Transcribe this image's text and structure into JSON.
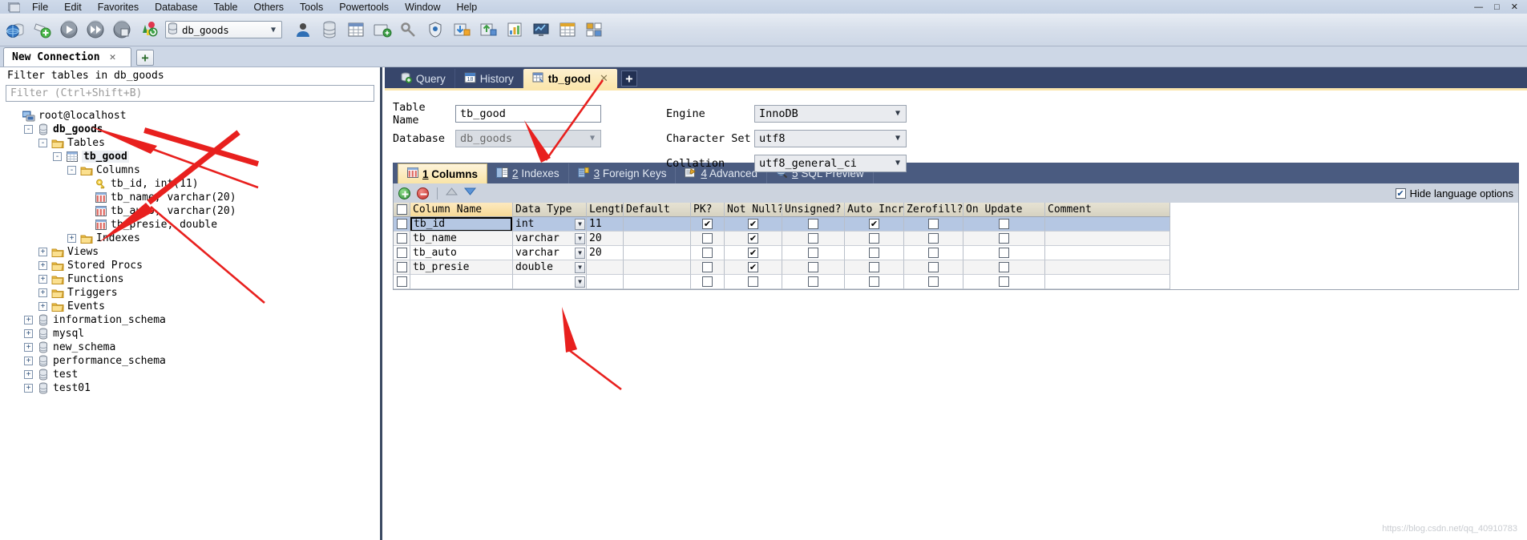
{
  "window": {
    "menu_items": [
      "File",
      "Edit",
      "Favorites",
      "Database",
      "Table",
      "Others",
      "Tools",
      "Powertools",
      "Window",
      "Help"
    ],
    "minimize_label": "—",
    "maximize_label": "□",
    "close_label": "✕",
    "app_icon": "app-window-icon"
  },
  "toolbar": {
    "buttons": [
      {
        "name": "new-connection-icon",
        "glyph": "connection"
      },
      {
        "name": "new-database-icon",
        "glyph": "newdb"
      },
      {
        "name": "execute-icon",
        "glyph": "play"
      },
      {
        "name": "execute-all-icon",
        "glyph": "forward"
      },
      {
        "name": "stop-icon",
        "glyph": "stop"
      },
      {
        "name": "refresh-objects-icon",
        "glyph": "refresh"
      }
    ],
    "db_selector": {
      "value": "db_goods",
      "icon": "database-icon",
      "chevron": "chevron-down-icon"
    },
    "right_buttons": [
      {
        "name": "user-manager-icon",
        "glyph": "user"
      },
      {
        "name": "database-icon",
        "glyph": "db"
      },
      {
        "name": "table-data-icon",
        "glyph": "table"
      },
      {
        "name": "backup-icon",
        "glyph": "backup"
      },
      {
        "name": "key-icon",
        "glyph": "key"
      },
      {
        "name": "security-icon",
        "glyph": "shield"
      },
      {
        "name": "import-icon",
        "glyph": "import"
      },
      {
        "name": "export-icon",
        "glyph": "export"
      },
      {
        "name": "report-icon",
        "glyph": "report"
      },
      {
        "name": "monitor-icon",
        "glyph": "monitor"
      },
      {
        "name": "grid-view-icon",
        "glyph": "grid"
      },
      {
        "name": "tile-view-icon",
        "glyph": "tile"
      }
    ]
  },
  "connection_tabs": {
    "tabs": [
      {
        "label": "New Connection",
        "close": "✕"
      }
    ],
    "add_label": "+"
  },
  "sidebar": {
    "filter_title": "Filter tables in db_goods",
    "filter_placeholder": "Filter (Ctrl+Shift+B)",
    "tree": [
      {
        "label": "root@localhost",
        "indent": 0,
        "expander": "",
        "icon": "server-icon",
        "bold": false,
        "selected": false
      },
      {
        "label": "db_goods",
        "indent": 1,
        "expander": "-",
        "icon": "database-icon",
        "bold": true,
        "selected": false
      },
      {
        "label": "Tables",
        "indent": 2,
        "expander": "-",
        "icon": "folder-icon",
        "bold": false,
        "selected": false
      },
      {
        "label": "tb_good",
        "indent": 3,
        "expander": "-",
        "icon": "table-icon",
        "bold": true,
        "selected": true
      },
      {
        "label": "Columns",
        "indent": 4,
        "expander": "-",
        "icon": "folder-icon",
        "bold": false,
        "selected": false
      },
      {
        "label": "tb_id, int(11)",
        "indent": 5,
        "expander": "",
        "icon": "key-icon",
        "bold": false,
        "selected": false
      },
      {
        "label": "tb_name, varchar(20)",
        "indent": 5,
        "expander": "",
        "icon": "column-icon",
        "bold": false,
        "selected": false
      },
      {
        "label": "tb_auto, varchar(20)",
        "indent": 5,
        "expander": "",
        "icon": "column-icon",
        "bold": false,
        "selected": false
      },
      {
        "label": "tb_presie, double",
        "indent": 5,
        "expander": "",
        "icon": "column-icon",
        "bold": false,
        "selected": false
      },
      {
        "label": "Indexes",
        "indent": 4,
        "expander": "+",
        "icon": "folder-icon",
        "bold": false,
        "selected": false
      },
      {
        "label": "Views",
        "indent": 2,
        "expander": "+",
        "icon": "folder-icon",
        "bold": false,
        "selected": false
      },
      {
        "label": "Stored Procs",
        "indent": 2,
        "expander": "+",
        "icon": "folder-icon",
        "bold": false,
        "selected": false
      },
      {
        "label": "Functions",
        "indent": 2,
        "expander": "+",
        "icon": "folder-icon",
        "bold": false,
        "selected": false
      },
      {
        "label": "Triggers",
        "indent": 2,
        "expander": "+",
        "icon": "folder-icon",
        "bold": false,
        "selected": false
      },
      {
        "label": "Events",
        "indent": 2,
        "expander": "+",
        "icon": "folder-icon",
        "bold": false,
        "selected": false
      },
      {
        "label": "information_schema",
        "indent": 1,
        "expander": "+",
        "icon": "database-icon",
        "bold": false,
        "selected": false
      },
      {
        "label": "mysql",
        "indent": 1,
        "expander": "+",
        "icon": "database-icon",
        "bold": false,
        "selected": false
      },
      {
        "label": "new_schema",
        "indent": 1,
        "expander": "+",
        "icon": "database-icon",
        "bold": false,
        "selected": false
      },
      {
        "label": "performance_schema",
        "indent": 1,
        "expander": "+",
        "icon": "database-icon",
        "bold": false,
        "selected": false
      },
      {
        "label": "test",
        "indent": 1,
        "expander": "+",
        "icon": "database-icon",
        "bold": false,
        "selected": false
      },
      {
        "label": "test01",
        "indent": 1,
        "expander": "+",
        "icon": "database-icon",
        "bold": false,
        "selected": false
      }
    ]
  },
  "editor": {
    "tabs": [
      {
        "label": "Query",
        "icon": "query-icon",
        "active": false,
        "closable": false
      },
      {
        "label": "History",
        "icon": "history-icon",
        "active": false,
        "closable": false
      },
      {
        "label": "tb_good",
        "icon": "table-icon",
        "active": true,
        "closable": true,
        "close": "✕"
      }
    ],
    "add_label": "+"
  },
  "table_form": {
    "table_name_label": "Table Name",
    "table_name_value": "tb_good",
    "database_label": "Database",
    "database_value": "db_goods",
    "engine_label": "Engine",
    "engine_value": "InnoDB",
    "charset_label": "Character Set",
    "charset_value": "utf8",
    "collation_label": "Collation",
    "collation_value": "utf8_general_ci",
    "chevron": "chevron-down-icon"
  },
  "inner_tabs": [
    {
      "num": "1",
      "label": "Columns",
      "icon": "columns-icon",
      "active": true
    },
    {
      "num": "2",
      "label": "Indexes",
      "icon": "indexes-icon",
      "active": false
    },
    {
      "num": "3",
      "label": "Foreign Keys",
      "icon": "foreign-keys-icon",
      "active": false
    },
    {
      "num": "4",
      "label": "Advanced",
      "icon": "advanced-icon",
      "active": false
    },
    {
      "num": "5",
      "label": "SQL Preview",
      "icon": "sql-preview-icon",
      "active": false
    }
  ],
  "grid_toolbar": {
    "add_icon": "add-row-icon",
    "delete_icon": "delete-row-icon",
    "move_up_icon": "move-up-icon",
    "move_down_icon": "move-down-icon",
    "hide_language_label": "Hide language options",
    "hide_language_checked": true,
    "check_glyph": "✔"
  },
  "grid": {
    "columns": [
      "Column Name",
      "Data Type",
      "Length",
      "Default",
      "PK?",
      "Not Null?",
      "Unsigned?",
      "Auto Incr?",
      "Zerofill?",
      "On Update",
      "Comment"
    ],
    "rows": [
      {
        "name": "tb_id",
        "type": "int",
        "length": "11",
        "default": "",
        "pk": true,
        "notnull": true,
        "unsigned": false,
        "autoincr": true,
        "zerofill": false,
        "onupdate": false,
        "comment": "",
        "selected": true
      },
      {
        "name": "tb_name",
        "type": "varchar",
        "length": "20",
        "default": "",
        "pk": false,
        "notnull": true,
        "unsigned": false,
        "autoincr": false,
        "zerofill": false,
        "onupdate": false,
        "comment": "",
        "selected": false
      },
      {
        "name": "tb_auto",
        "type": "varchar",
        "length": "20",
        "default": "",
        "pk": false,
        "notnull": true,
        "unsigned": false,
        "autoincr": false,
        "zerofill": false,
        "onupdate": false,
        "comment": "",
        "selected": false
      },
      {
        "name": "tb_presie",
        "type": "double",
        "length": "",
        "default": "",
        "pk": false,
        "notnull": true,
        "unsigned": false,
        "autoincr": false,
        "zerofill": false,
        "onupdate": false,
        "comment": "",
        "selected": false
      },
      {
        "name": "",
        "type": "",
        "length": "",
        "default": "",
        "pk": false,
        "notnull": false,
        "unsigned": false,
        "autoincr": false,
        "zerofill": false,
        "onupdate": false,
        "comment": "",
        "selected": false
      }
    ],
    "check_glyph": "✔"
  },
  "watermark": "https://blog.csdn.net/qq_40910783",
  "colors": {
    "accent_yellow": "#fbe6ad",
    "tab_navy": "#37466b",
    "inner_tab_navy": "#4a5b80",
    "selection_blue": "#b5c7e3",
    "arrow_red": "#e8201e"
  }
}
